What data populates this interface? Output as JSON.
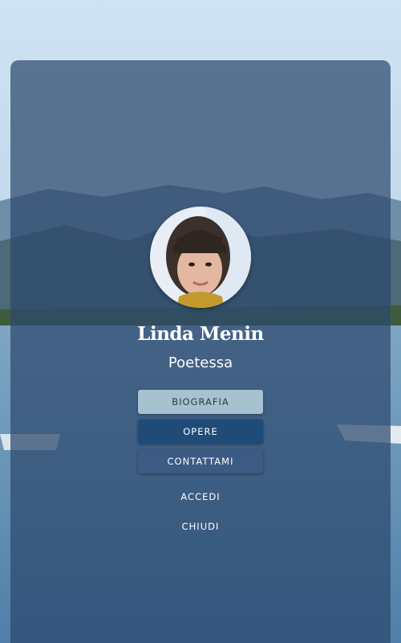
{
  "profile": {
    "name": "Linda Menin",
    "role": "Poetessa"
  },
  "menu": {
    "biografia": "BIOGRAFIA",
    "opere": "OPERE",
    "contattami": "CONTATTAMI",
    "accedi": "ACCEDI",
    "chiudi": "CHIUDI"
  },
  "colors": {
    "overlay": "#2c486e",
    "active_button": "#a7c2cf",
    "button_dark": "#1f4b78",
    "button_mid": "#3b5b85",
    "text": "#ffffff"
  }
}
